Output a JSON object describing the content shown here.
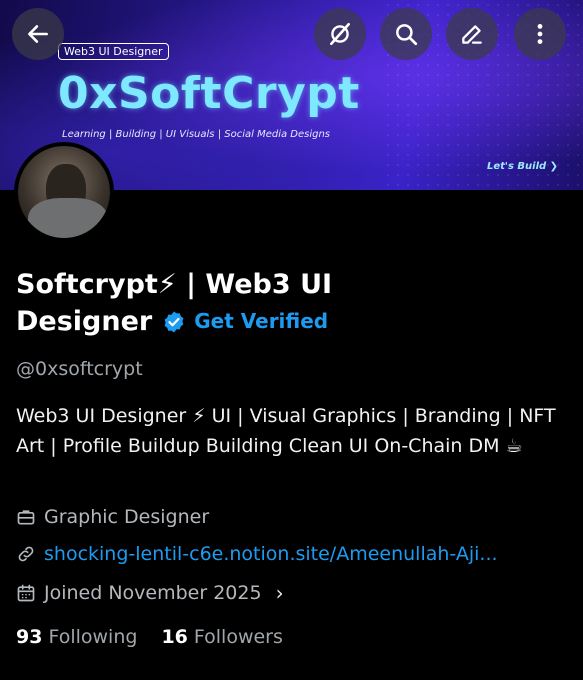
{
  "banner": {
    "tag": "Web3 UI Designer",
    "title": "0xSoftCrypt",
    "subtitle": "Learning | Building | UI Visuals | Social Media Designs",
    "cta": "Let's Build ❯"
  },
  "topbar": {
    "icons": [
      "back-arrow-icon",
      "grok-icon",
      "search-icon",
      "edit-icon",
      "more-icon"
    ]
  },
  "profile": {
    "name_line1": "Softcrypt⚡ | Web3 UI",
    "name_line2": "Designer",
    "get_verified": "Get Verified",
    "handle": "@0xsoftcrypt",
    "bio": "Web3 UI Designer ⚡  UI | Visual Graphics | Branding | NFT Art | Profile Buildup  Building Clean UI On-Chain DM ☕",
    "profession": "Graphic Designer",
    "link": "shocking-lentil-c6e.notion.site/Ameenullah-Aji...",
    "joined": "Joined November 2025",
    "following_count": "93",
    "following_label": "Following",
    "followers_count": "16",
    "followers_label": "Followers"
  },
  "colors": {
    "accent": "#1d9bf0",
    "background": "#000000",
    "banner_title": "#7ee8ff"
  }
}
